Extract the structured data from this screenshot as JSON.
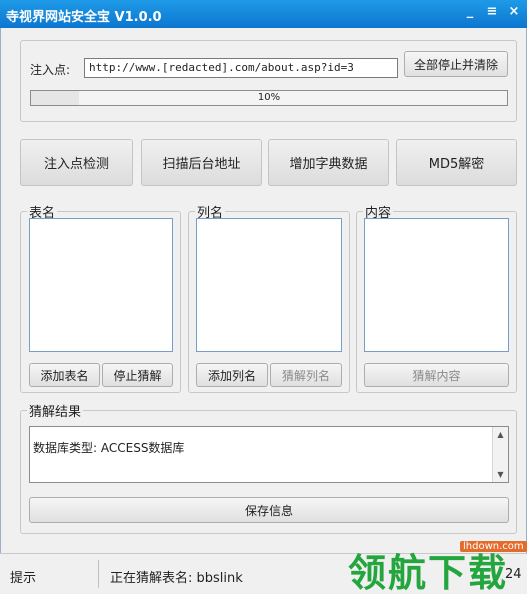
{
  "window": {
    "title": "寺视界网站安全宝 V1.0.0",
    "controls": [
      "_",
      "≡",
      "×"
    ]
  },
  "injection": {
    "label": "注入点:",
    "url_value": "http://www.[redacted].com/about.asp?id=3",
    "stop_clear_button": "全部停止并清除",
    "progress_text": "10%",
    "progress_fraction": 0.1
  },
  "actions": {
    "detect": "注入点检测",
    "scan_admin": "扫描后台地址",
    "add_dict": "增加字典数据",
    "md5": "MD5解密"
  },
  "tables_group": {
    "legend": "表名",
    "add_button": "添加表名",
    "stop_button": "停止猜解"
  },
  "columns_group": {
    "legend": "列名",
    "add_button": "添加列名",
    "guess_button": "猜解列名"
  },
  "content_group": {
    "legend": "内容",
    "guess_button": "猜解内容"
  },
  "result": {
    "legend": "猜解结果",
    "text": "数据库类型: ACCESS数据库",
    "save_button": "保存信息"
  },
  "status": {
    "hint": "提示",
    "message": "正在猜解表名: bbslink",
    "right": "24"
  },
  "watermark": {
    "text": "领航下载",
    "url": "lhdown.com"
  }
}
